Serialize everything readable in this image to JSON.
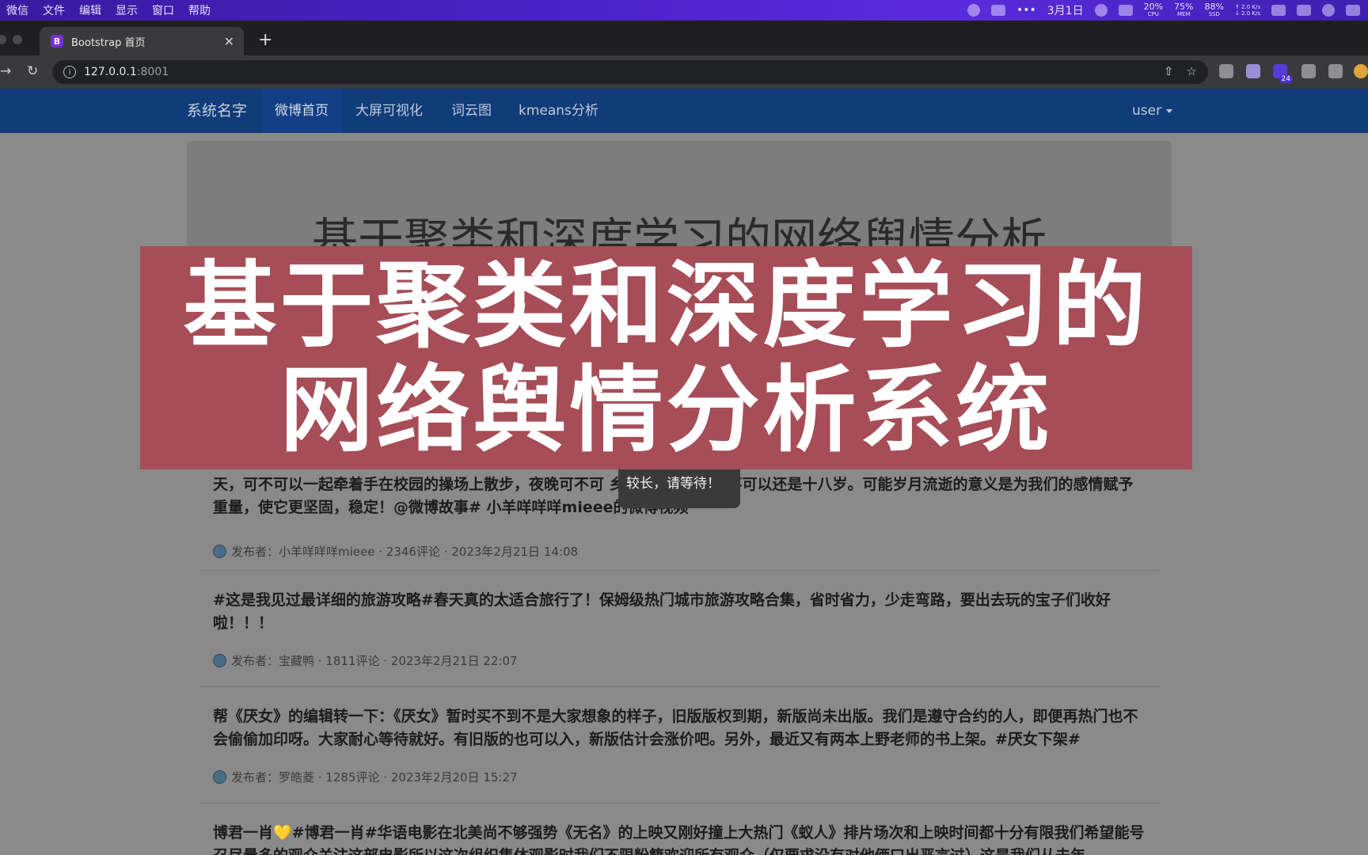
{
  "menubar": {
    "items": [
      "微信",
      "文件",
      "编辑",
      "显示",
      "窗口",
      "帮助"
    ],
    "date": "3月1日",
    "stats": [
      {
        "value": "20%",
        "label": "CPU"
      },
      {
        "value": "75%",
        "label": "MEM"
      },
      {
        "value": "88%",
        "label": "SSD"
      }
    ],
    "net_up": "↑ 2.0 K/s",
    "net_down": "↓ 2.0 K/s"
  },
  "browser": {
    "tab_title": "Bootstrap 首页",
    "tab_favicon": "B",
    "new_tab": "+",
    "url_host": "127.0.0.1",
    "url_port": ":8001",
    "ext_badge": "24"
  },
  "navbar": {
    "brand": "系统名字",
    "links": [
      "微博首页",
      "大屏可视化",
      "词云图",
      "kmeans分析"
    ],
    "user": "user"
  },
  "jumbotron": {
    "title": "基于聚类和深度学习的网络舆情分析"
  },
  "posts": [
    {
      "text": "天，可不可以一起牵着手在校园的操场上散步，夜晚可不可 乡年味大赏#我可不可以还是十八岁。可能岁月流逝的意义是为我们的感情赋予重量，使它更坚固，稳定！@微博故事# 小羊咩咩咩mieee的微博视频",
      "meta": "发布者：小羊咩咩咩mieee · 2346评论 · 2023年2月21日 14:08"
    },
    {
      "text": "#这是我见过最详细的旅游攻略#春天真的太适合旅行了！保姆级热门城市旅游攻略合集，省时省力，少走弯路，要出去玩的宝子们收好啦！！！",
      "meta": "发布者：宝藏鸭 · 1811评论 · 2023年2月21日 22:07"
    },
    {
      "text": "帮《厌女》的编辑转一下：《厌女》暂时买不到不是大家想象的样子，旧版版权到期，新版尚未出版。我们是遵守合约的人，即便再热门也不会偷偷加印呀。大家耐心等待就好。有旧版的也可以入，新版估计会涨价吧。另外，最近又有两本上野老师的书上架。#厌女下架#",
      "meta": "发布者：罗皓菱 · 1285评论 · 2023年2月20日 15:27"
    },
    {
      "text": "博君一肖💛#博君一肖#华语电影在北美尚不够强势《无名》的上映又刚好撞上大热门《蚁人》排片场次和上映时间都十分有限我们希望能号召尽量多的观众关注这部电影所以这次组织集体观影时我们不限粉籍欢迎所有观众（仅要求没有对他俩口出恶言过）这是我们从去年",
      "meta": ""
    }
  ],
  "toast": {
    "text": "正在爬取，时间较长，请等待！"
  },
  "banner": {
    "line1": "基于聚类和深度学习的",
    "line2": "网络舆情分析系统"
  }
}
